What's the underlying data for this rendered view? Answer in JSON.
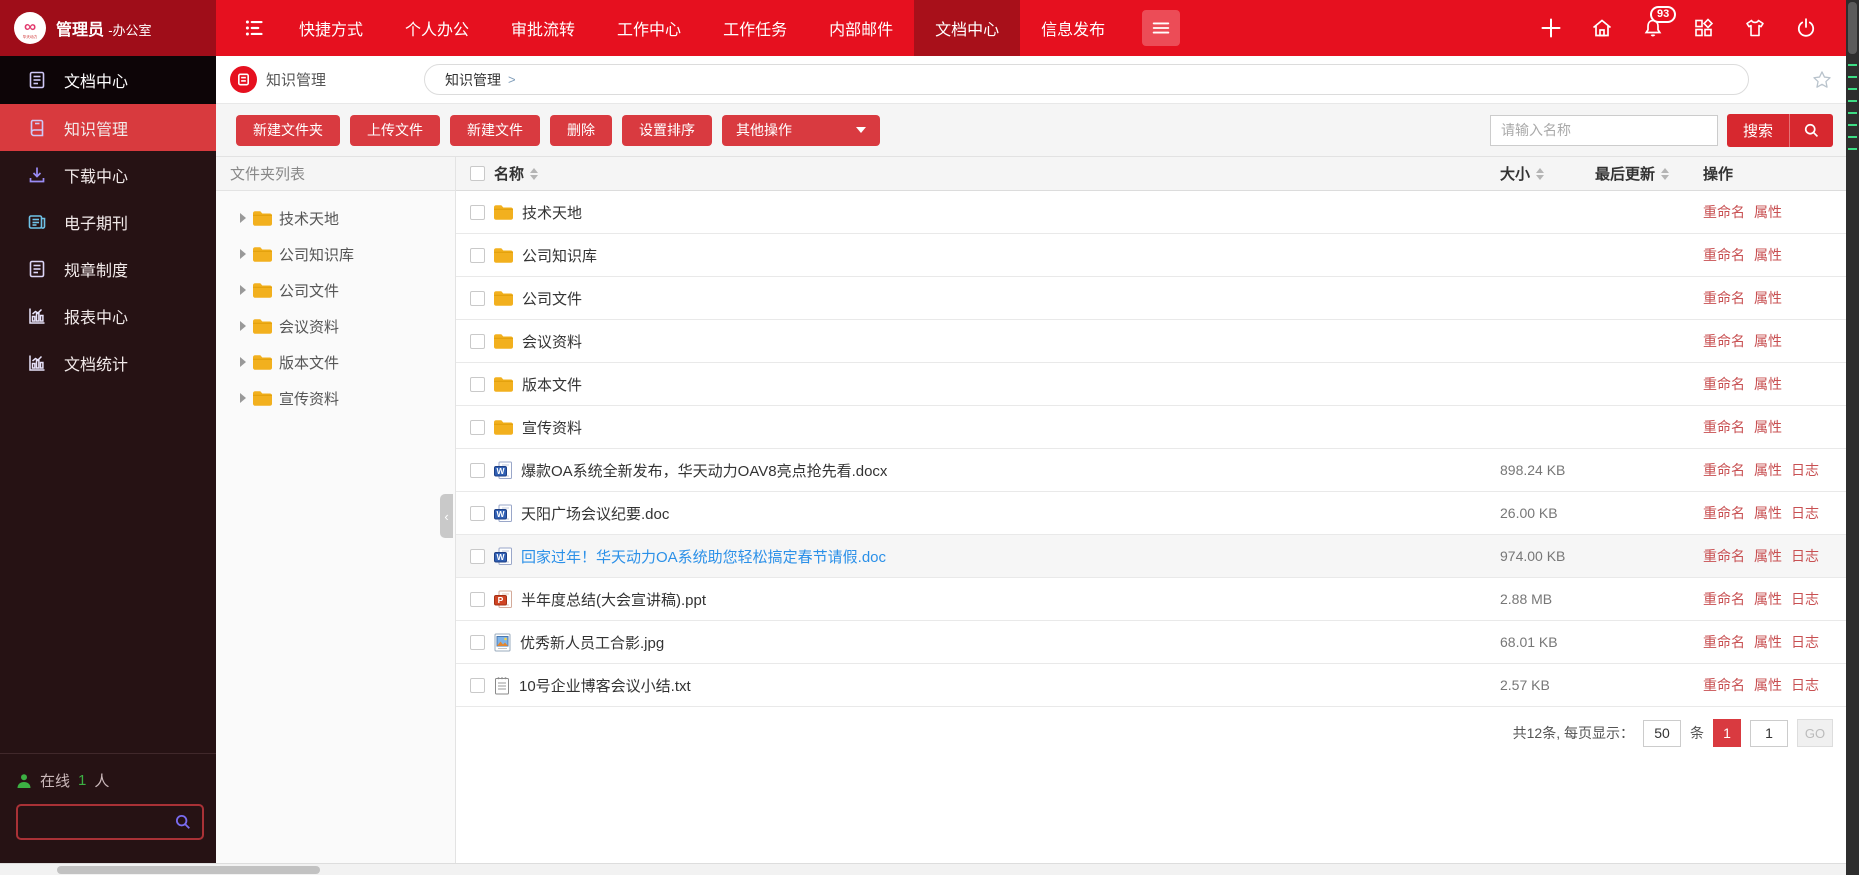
{
  "colors": {
    "accent": "#e6101f",
    "accentdark": "#9f0d19",
    "navactive": "#a8101a",
    "button": "#d93a40",
    "sidebar": "#261214",
    "sidebarblack": "#0d0507",
    "sidebaractive": "#d83a3e",
    "link": "#2b90e8",
    "folder": "#f2b01e",
    "online": "#3cb043",
    "action": "#c85052",
    "iconpurple": "#9a8cf5"
  },
  "topbar": {
    "user_name": "管理员",
    "user_dept": "-办公室",
    "nav": [
      "快捷方式",
      "个人办公",
      "审批流转",
      "工作中心",
      "工作任务",
      "内部邮件",
      "文档中心",
      "信息发布"
    ],
    "active_nav": "文档中心",
    "badge_count": "93",
    "action_icons": [
      "plus-icon",
      "home-icon",
      "bell-icon",
      "apps-grid-icon",
      "theme-shirt-icon",
      "power-icon"
    ]
  },
  "sidebar": {
    "section": "文档中心",
    "items": [
      "知识管理",
      "下载中心",
      "电子期刊",
      "规章制度",
      "报表中心",
      "文档统计"
    ],
    "item_icons": [
      "book-icon",
      "download-icon",
      "journal-icon",
      "rules-icon",
      "chart-icon",
      "chart-icon"
    ],
    "active_item": "知识管理",
    "online_label": "在线",
    "online_count": "1",
    "online_suffix": "人"
  },
  "header": {
    "title": "知识管理",
    "breadcrumb": "知识管理",
    "breadcrumb_sep": ">"
  },
  "toolbar": {
    "buttons": [
      "新建文件夹",
      "上传文件",
      "新建文件",
      "删除",
      "设置排序"
    ],
    "dropdown": "其他操作",
    "search_placeholder": "请输入名称",
    "search_label": "搜索"
  },
  "tree": {
    "title": "文件夹列表",
    "folders": [
      "技术天地",
      "公司知识库",
      "公司文件",
      "会议资料",
      "版本文件",
      "宣传资料"
    ]
  },
  "table": {
    "columns": {
      "name": "名称",
      "size": "大小",
      "updated": "最后更新",
      "actions": "操作"
    },
    "rows": [
      {
        "name": "技术天地",
        "type": "folder",
        "size": "",
        "updated": "",
        "actions": [
          "重命名",
          "属性"
        ],
        "link": false,
        "highlight": false
      },
      {
        "name": "公司知识库",
        "type": "folder",
        "size": "",
        "updated": "",
        "actions": [
          "重命名",
          "属性"
        ],
        "link": false,
        "highlight": false
      },
      {
        "name": "公司文件",
        "type": "folder",
        "size": "",
        "updated": "",
        "actions": [
          "重命名",
          "属性"
        ],
        "link": false,
        "highlight": false
      },
      {
        "name": "会议资料",
        "type": "folder",
        "size": "",
        "updated": "",
        "actions": [
          "重命名",
          "属性"
        ],
        "link": false,
        "highlight": false
      },
      {
        "name": "版本文件",
        "type": "folder",
        "size": "",
        "updated": "",
        "actions": [
          "重命名",
          "属性"
        ],
        "link": false,
        "highlight": false
      },
      {
        "name": "宣传资料",
        "type": "folder",
        "size": "",
        "updated": "",
        "actions": [
          "重命名",
          "属性"
        ],
        "link": false,
        "highlight": false
      },
      {
        "name": "爆款OA系统全新发布，华天动力OAV8亮点抢先看.docx",
        "type": "word",
        "size": "898.24 KB",
        "updated": "",
        "actions": [
          "重命名",
          "属性",
          "日志"
        ],
        "link": false,
        "highlight": false
      },
      {
        "name": "天阳广场会议纪要.doc",
        "type": "word",
        "size": "26.00 KB",
        "updated": "",
        "actions": [
          "重命名",
          "属性",
          "日志"
        ],
        "link": false,
        "highlight": false
      },
      {
        "name": "回家过年！华天动力OA系统助您轻松搞定春节请假.doc",
        "type": "word",
        "size": "974.00 KB",
        "updated": "",
        "actions": [
          "重命名",
          "属性",
          "日志"
        ],
        "link": true,
        "highlight": true
      },
      {
        "name": "半年度总结(大会宣讲稿).ppt",
        "type": "ppt",
        "size": "2.88 MB",
        "updated": "",
        "actions": [
          "重命名",
          "属性",
          "日志"
        ],
        "link": false,
        "highlight": false
      },
      {
        "name": "优秀新人员工合影.jpg",
        "type": "image",
        "size": "68.01 KB",
        "updated": "",
        "actions": [
          "重命名",
          "属性",
          "日志"
        ],
        "link": false,
        "highlight": false
      },
      {
        "name": "10号企业博客会议小结.txt",
        "type": "txt",
        "size": "2.57 KB",
        "updated": "",
        "actions": [
          "重命名",
          "属性",
          "日志"
        ],
        "link": false,
        "highlight": false
      }
    ]
  },
  "pagination": {
    "total_text": "共12条, 每页显示：",
    "page_size": "50",
    "unit": "条",
    "current_page": "1",
    "goto_value": "1",
    "go_label": "GO"
  }
}
